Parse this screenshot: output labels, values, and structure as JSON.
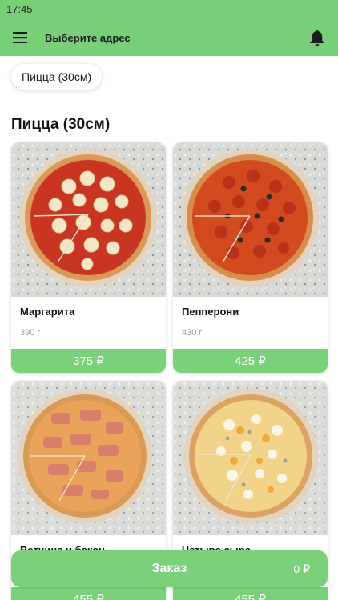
{
  "status_bar": {
    "time": "17:45"
  },
  "app_bar": {
    "title": "Выберите адрес",
    "menu_icon": "hamburger-menu-icon",
    "bell_icon": "bell-icon"
  },
  "category_chip": {
    "label": "Пицца (30см)"
  },
  "section": {
    "title": "Пицца (30см)"
  },
  "products": [
    {
      "name": "Маргарита",
      "weight": "390 г",
      "price": "375 ₽",
      "topping": "margherita"
    },
    {
      "name": "Пепперони",
      "weight": "430 г",
      "price": "425 ₽",
      "topping": "pepperoni"
    },
    {
      "name": "Ветчина и бекон",
      "weight": "",
      "price": "455 ₽",
      "topping": "ham"
    },
    {
      "name": "Четыре сыра",
      "weight": "",
      "price": "455 ₽",
      "topping": "cheese"
    }
  ],
  "order": {
    "label": "Заказ",
    "total": "0 ₽"
  },
  "colors": {
    "accent": "#7bd17a",
    "status_bar": "#79cf78"
  }
}
